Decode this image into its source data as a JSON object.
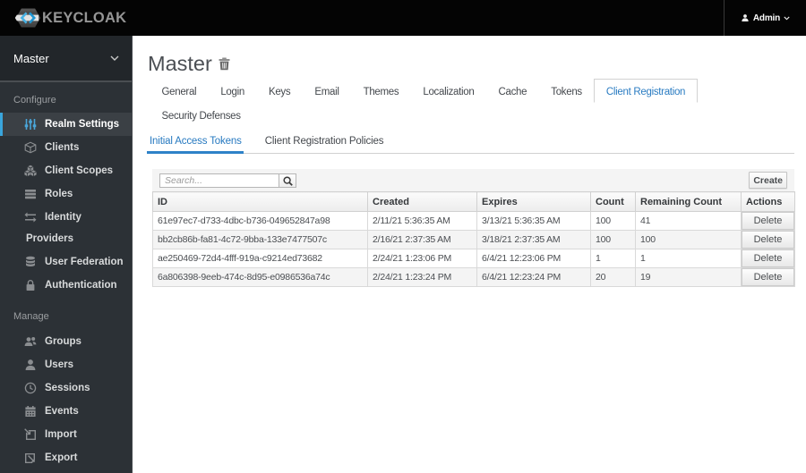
{
  "topbar": {
    "brand": "KEYCLOAK",
    "user": "Admin"
  },
  "sidebar": {
    "realm_selector": "Master",
    "configure": {
      "label": "Configure",
      "items": [
        {
          "label": "Realm Settings",
          "icon": "sliders-icon",
          "active": true
        },
        {
          "label": "Clients",
          "icon": "cube-icon",
          "active": false
        },
        {
          "label": "Client Scopes",
          "icon": "cubes-icon",
          "active": false
        },
        {
          "label": "Roles",
          "icon": "list-icon",
          "active": false
        },
        {
          "label": "Identity Providers",
          "icon": "exchange-icon",
          "active": false
        },
        {
          "label": "User Federation",
          "icon": "database-icon",
          "active": false
        },
        {
          "label": "Authentication",
          "icon": "lock-icon",
          "active": false
        }
      ]
    },
    "manage": {
      "label": "Manage",
      "items": [
        {
          "label": "Groups",
          "icon": "people-icon",
          "active": false
        },
        {
          "label": "Users",
          "icon": "person-icon",
          "active": false
        },
        {
          "label": "Sessions",
          "icon": "clock-icon",
          "active": false
        },
        {
          "label": "Events",
          "icon": "calendar-icon",
          "active": false
        },
        {
          "label": "Import",
          "icon": "import-icon",
          "active": false
        },
        {
          "label": "Export",
          "icon": "export-icon",
          "active": false
        }
      ]
    }
  },
  "main": {
    "title": "Master",
    "tabs": [
      "General",
      "Login",
      "Keys",
      "Email",
      "Themes",
      "Localization",
      "Cache",
      "Tokens",
      "Client Registration",
      "Security Defenses"
    ],
    "active_tab": "Client Registration",
    "subtabs": [
      "Initial Access Tokens",
      "Client Registration Policies"
    ],
    "active_subtab": "Initial Access Tokens",
    "toolbar": {
      "search_placeholder": "Search...",
      "create_label": "Create"
    },
    "table": {
      "columns": [
        "ID",
        "Created",
        "Expires",
        "Count",
        "Remaining Count",
        "Actions"
      ],
      "rows": [
        {
          "id": "61e97ec7-d733-4dbc-b736-049652847a98",
          "created": "2/11/21 5:36:35 AM",
          "expires": "3/13/21 5:36:35 AM",
          "count": "100",
          "remaining": "41",
          "action": "Delete"
        },
        {
          "id": "bb2cb86b-fa81-4c72-9bba-133e7477507c",
          "created": "2/16/21 2:37:35 AM",
          "expires": "3/18/21 2:37:35 AM",
          "count": "100",
          "remaining": "100",
          "action": "Delete"
        },
        {
          "id": "ae250469-72d4-4fff-919a-c9214ed73682",
          "created": "2/24/21 1:23:06 PM",
          "expires": "6/4/21 12:23:06 PM",
          "count": "1",
          "remaining": "1",
          "action": "Delete"
        },
        {
          "id": "6a806398-9eeb-474c-8d95-e0986536a74c",
          "created": "2/24/21 1:23:24 PM",
          "expires": "6/4/21 12:23:24 PM",
          "count": "20",
          "remaining": "19",
          "action": "Delete"
        }
      ]
    }
  },
  "colors": {
    "accent_blue": "#2a7cc2",
    "active_nav_border": "#39a5dc",
    "sidebar_bg": "#2c3136",
    "topbar_bg": "#040404"
  }
}
